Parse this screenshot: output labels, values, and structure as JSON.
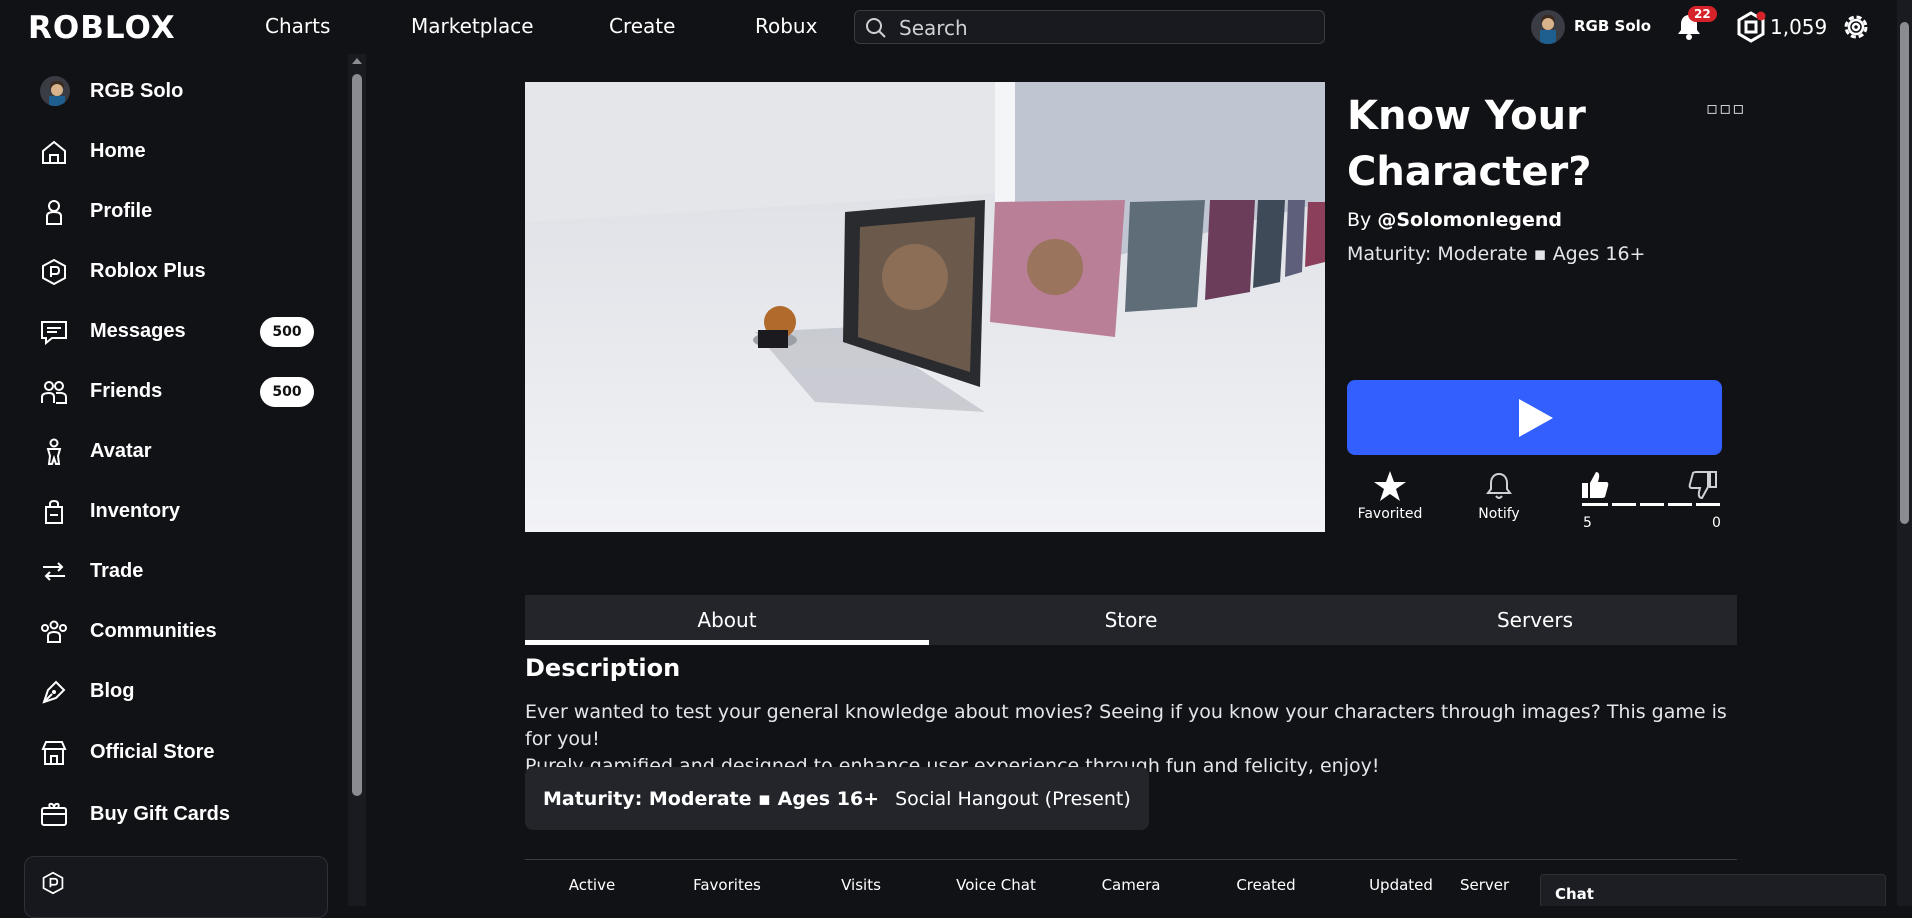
{
  "header": {
    "logo": "ROBLOX",
    "nav": [
      "Charts",
      "Marketplace",
      "Create",
      "Robux"
    ],
    "search_placeholder": "Search",
    "username": "RGB Solo",
    "notifications_count": "22",
    "robux_balance": "1,059"
  },
  "sidebar": {
    "items": [
      {
        "label": "RGB Solo",
        "icon": "avatar"
      },
      {
        "label": "Home",
        "icon": "home-icon"
      },
      {
        "label": "Profile",
        "icon": "profile-icon"
      },
      {
        "label": "Roblox Plus",
        "icon": "roblox-plus-icon"
      },
      {
        "label": "Messages",
        "icon": "messages-icon",
        "badge": "500"
      },
      {
        "label": "Friends",
        "icon": "friends-icon",
        "badge": "500"
      },
      {
        "label": "Avatar",
        "icon": "avatar-icon"
      },
      {
        "label": "Inventory",
        "icon": "inventory-icon"
      },
      {
        "label": "Trade",
        "icon": "trade-icon"
      },
      {
        "label": "Communities",
        "icon": "communities-icon"
      },
      {
        "label": "Blog",
        "icon": "blog-icon"
      },
      {
        "label": "Official Store",
        "icon": "store-icon"
      },
      {
        "label": "Buy Gift Cards",
        "icon": "gift-card-icon"
      }
    ]
  },
  "game": {
    "title": "Know Your Character?",
    "creator_prefix": "By ",
    "creator": "@Solomonlegend",
    "maturity": "Maturity: Moderate ▪ Ages 16+",
    "favorite_label": "Favorited",
    "notify_label": "Notify",
    "upvotes": "5",
    "downvotes": "0",
    "like_ratio": 1.0
  },
  "tabs": [
    "About",
    "Store",
    "Servers"
  ],
  "about": {
    "heading": "Description",
    "line1": "Ever wanted to test your general knowledge about movies? Seeing if you know your characters through images? This game is for you!",
    "line2": "Purely gamified and designed to enhance user experience through fun and felicity, enjoy!",
    "maturity_tag": "Maturity: Moderate ▪ Ages 16+",
    "genre_tag": "Social Hangout (Present)",
    "stats_headers": [
      "Active",
      "Favorites",
      "Visits",
      "Voice Chat",
      "Camera",
      "Created",
      "Updated",
      "Server"
    ]
  },
  "chat": {
    "label": "Chat"
  },
  "colors": {
    "play_button": "#335fff",
    "background": "#111216",
    "panel": "#23252b",
    "notification_badge": "#d6232a"
  }
}
